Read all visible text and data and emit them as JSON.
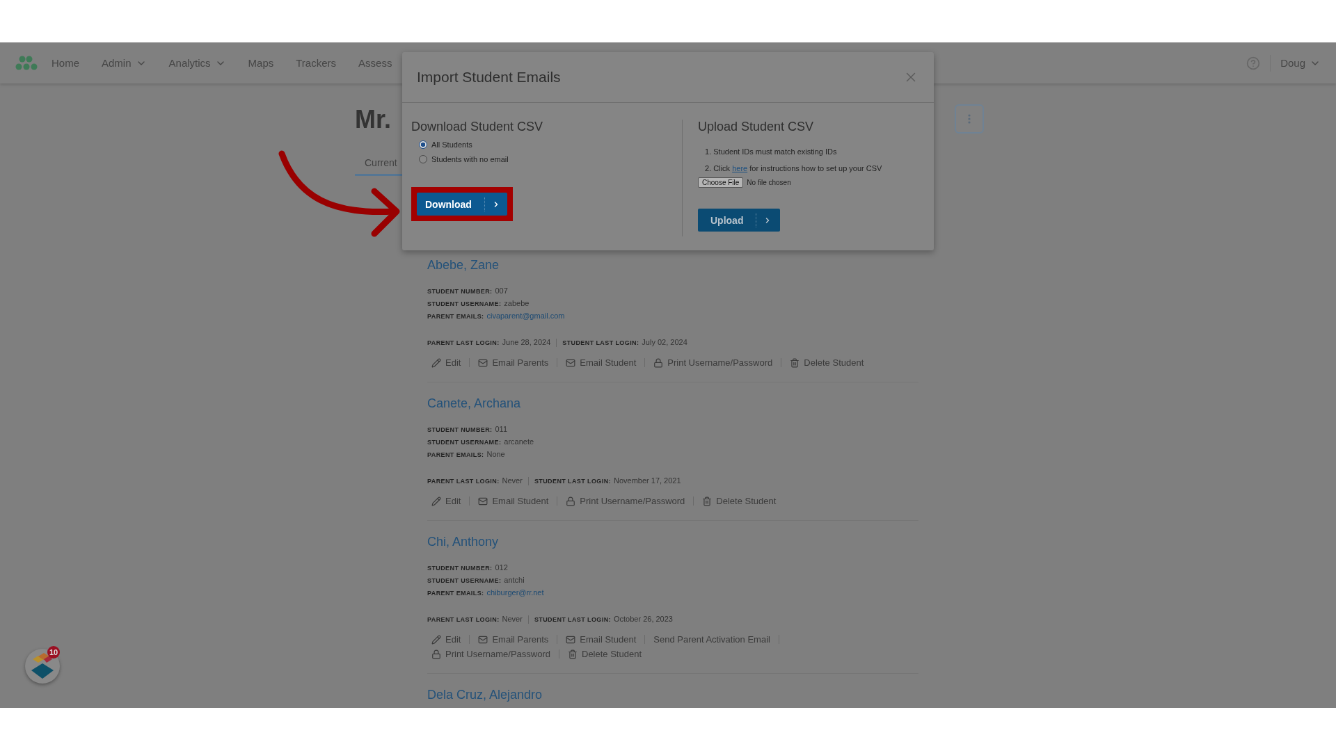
{
  "nav": {
    "items": [
      {
        "label": "Home",
        "has_menu": false
      },
      {
        "label": "Admin",
        "has_menu": true
      },
      {
        "label": "Analytics",
        "has_menu": true
      },
      {
        "label": "Maps",
        "has_menu": false
      },
      {
        "label": "Trackers",
        "has_menu": false
      },
      {
        "label": "Assess",
        "has_menu": false
      }
    ],
    "user": "Doug"
  },
  "page": {
    "title": "Mr.",
    "tab": "Current"
  },
  "students": [
    {
      "name": "Abebe, Zane",
      "fields": [
        {
          "label": "STUDENT NUMBER:",
          "value": "007",
          "kind": "text"
        },
        {
          "label": "STUDENT USERNAME:",
          "value": "zabebe",
          "kind": "text"
        },
        {
          "label": "PARENT EMAILS:",
          "value": "civaparent@gmail.com",
          "kind": "link"
        }
      ],
      "logins": [
        {
          "label": "PARENT LAST LOGIN:",
          "value": "June 28, 2024"
        },
        {
          "label": "STUDENT LAST LOGIN:",
          "value": "July 02, 2024"
        }
      ],
      "actions": [
        {
          "label": "Edit",
          "kind": "edit"
        },
        {
          "label": "Email Parents",
          "kind": "email"
        },
        {
          "label": "Email Student",
          "kind": "email"
        },
        {
          "label": "Print Username/Password",
          "kind": "print"
        },
        {
          "label": "Delete Student",
          "kind": "delete"
        }
      ]
    },
    {
      "name": "Canete, Archana",
      "fields": [
        {
          "label": "STUDENT NUMBER:",
          "value": "011",
          "kind": "text"
        },
        {
          "label": "STUDENT USERNAME:",
          "value": "arcanete",
          "kind": "text"
        },
        {
          "label": "PARENT EMAILS:",
          "value": "None",
          "kind": "text"
        }
      ],
      "logins": [
        {
          "label": "PARENT LAST LOGIN:",
          "value": "Never"
        },
        {
          "label": "STUDENT LAST LOGIN:",
          "value": "November 17, 2021"
        }
      ],
      "actions": [
        {
          "label": "Edit",
          "kind": "edit"
        },
        {
          "label": "Email Student",
          "kind": "email"
        },
        {
          "label": "Print Username/Password",
          "kind": "print"
        },
        {
          "label": "Delete Student",
          "kind": "delete"
        }
      ]
    },
    {
      "name": "Chi, Anthony",
      "fields": [
        {
          "label": "STUDENT NUMBER:",
          "value": "012",
          "kind": "text"
        },
        {
          "label": "STUDENT USERNAME:",
          "value": "antchi",
          "kind": "text"
        },
        {
          "label": "PARENT EMAILS:",
          "value": "chiburger@rr.net",
          "kind": "link"
        }
      ],
      "logins": [
        {
          "label": "PARENT LAST LOGIN:",
          "value": "Never"
        },
        {
          "label": "STUDENT LAST LOGIN:",
          "value": "October 26, 2023"
        }
      ],
      "actions": [
        {
          "label": "Edit",
          "kind": "edit"
        },
        {
          "label": "Email Parents",
          "kind": "email"
        },
        {
          "label": "Email Student",
          "kind": "email"
        },
        {
          "label": "Send Parent Activation Email",
          "kind": "activation"
        },
        {
          "label": "Print Username/Password",
          "kind": "print"
        },
        {
          "label": "Delete Student",
          "kind": "delete"
        }
      ]
    },
    {
      "name": "Dela Cruz, Alejandro"
    }
  ],
  "modal": {
    "title": "Import Student Emails",
    "download": {
      "heading": "Download Student CSV",
      "options": [
        {
          "label": "All Students",
          "selected": true
        },
        {
          "label": "Students with no email",
          "selected": false
        }
      ],
      "button": "Download",
      "highlighted": true
    },
    "upload": {
      "heading": "Upload Student CSV",
      "steps": [
        {
          "number": "1.",
          "before": "Student IDs must match existing IDs"
        },
        {
          "number": "2.",
          "before": "Click",
          "link": "here",
          "after": "for instructions how to set up your CSV"
        }
      ],
      "file_button": "Choose File",
      "file_status": "No file chosen",
      "button": "Upload"
    }
  },
  "helper": {
    "badge": "10"
  }
}
